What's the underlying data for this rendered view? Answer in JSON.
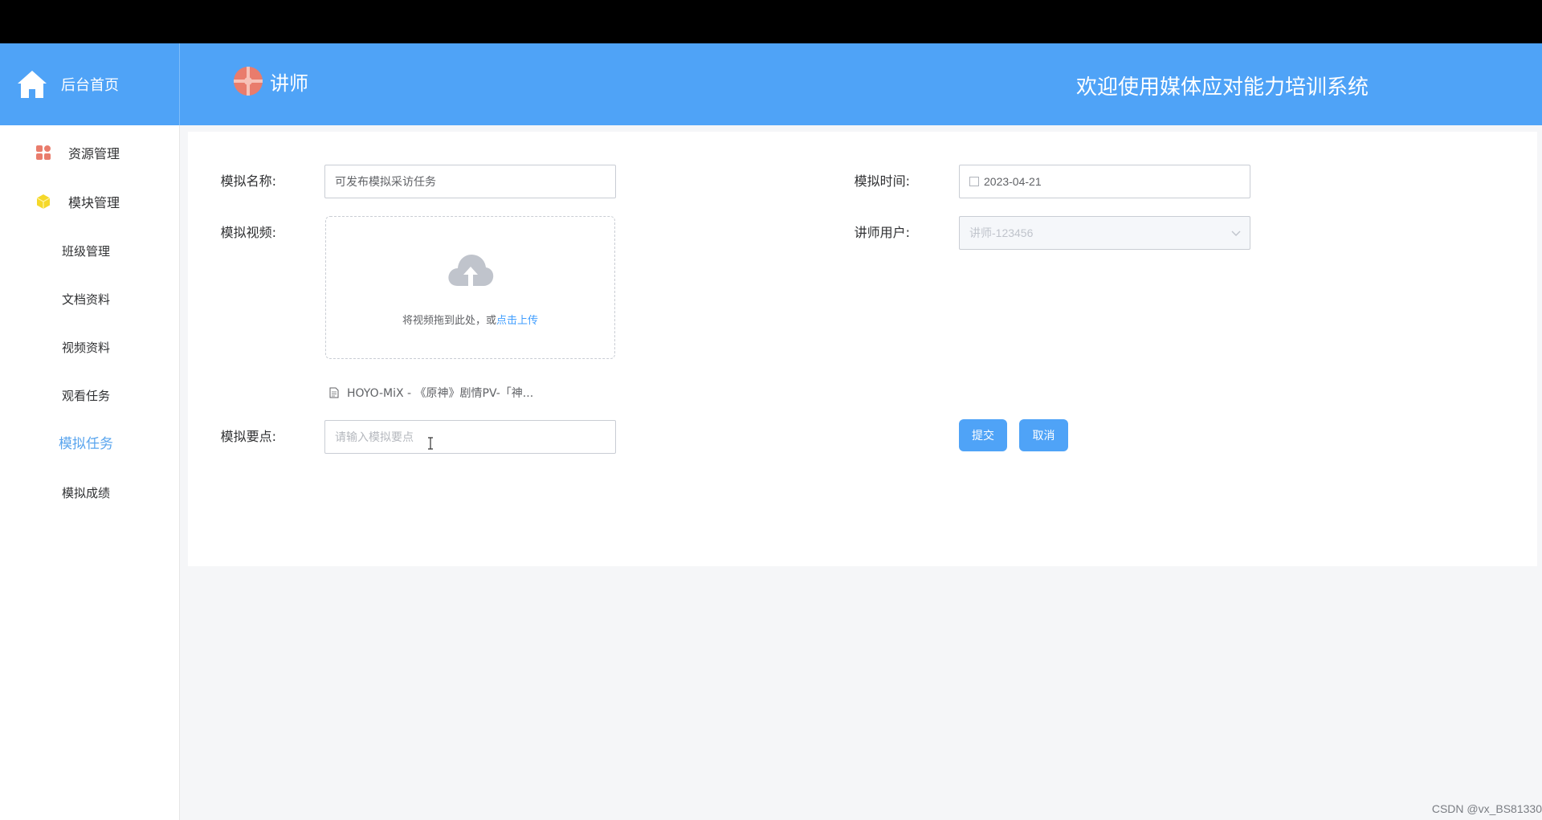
{
  "header": {
    "home_label": "后台首页",
    "brand_label": "讲师",
    "welcome_text": "欢迎使用媒体应对能力培训系统",
    "color": "#4fa3f7"
  },
  "sidebar": {
    "groups": [
      {
        "label": "资源管理",
        "icon": "resource-grid-icon"
      },
      {
        "label": "模块管理",
        "icon": "module-cube-icon"
      }
    ],
    "items": [
      {
        "label": "班级管理",
        "active": false
      },
      {
        "label": "文档资料",
        "active": false
      },
      {
        "label": "视频资料",
        "active": false
      },
      {
        "label": "观看任务",
        "active": false
      },
      {
        "label": "模拟任务",
        "active": true
      },
      {
        "label": "模拟成绩",
        "active": false
      }
    ],
    "active_color": "#5aa5ee"
  },
  "form": {
    "name": {
      "label": "模拟名称:",
      "value": "可发布模拟采访任务"
    },
    "time": {
      "label": "模拟时间:",
      "value": "2023-04-21"
    },
    "video": {
      "label": "模拟视频:",
      "upload_text": "将视频拖到此处，或",
      "upload_link": "点击上传",
      "file_name": "HOYO-MiX - 《原神》剧情PV-「神..."
    },
    "teacher": {
      "label": "讲师用户:",
      "value": "讲师-123456"
    },
    "points": {
      "label": "模拟要点:",
      "placeholder": "请输入模拟要点",
      "value": ""
    },
    "submit_label": "提交",
    "cancel_label": "取消"
  },
  "watermark": "CSDN @vx_BS81330"
}
